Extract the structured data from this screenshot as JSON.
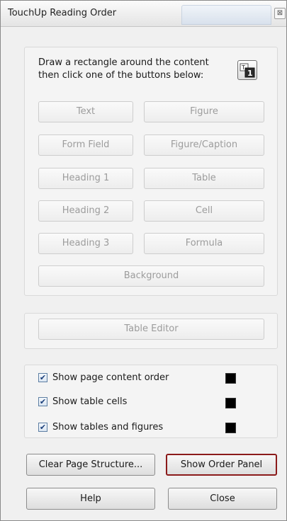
{
  "window": {
    "title": "TouchUp Reading Order",
    "close_glyph": "⊠"
  },
  "instructions": {
    "text": "Draw a rectangle around the content then click one of the buttons below:",
    "icon": "reading-order-icon"
  },
  "tag_buttons": {
    "text": "Text",
    "figure": "Figure",
    "form_field": "Form Field",
    "figure_caption": "Figure/Caption",
    "heading1": "Heading 1",
    "table": "Table",
    "heading2": "Heading 2",
    "cell": "Cell",
    "heading3": "Heading 3",
    "formula": "Formula",
    "background": "Background"
  },
  "table_editor": {
    "label": "Table Editor"
  },
  "options": {
    "show_page_content_order": {
      "label": "Show page content order",
      "checked": true,
      "color": "#000000"
    },
    "show_table_cells": {
      "label": "Show table cells",
      "checked": true,
      "color": "#000000"
    },
    "show_tables_figures": {
      "label": "Show tables and figures",
      "checked": true,
      "color": "#000000"
    },
    "check_glyph": "✔"
  },
  "actions": {
    "clear_page_structure": "Clear Page Structure...",
    "show_order_panel": "Show Order Panel",
    "help": "Help",
    "close": "Close"
  },
  "colors": {
    "default_button_border": "#8b1a1a",
    "disabled_text": "#9c9c9c"
  }
}
